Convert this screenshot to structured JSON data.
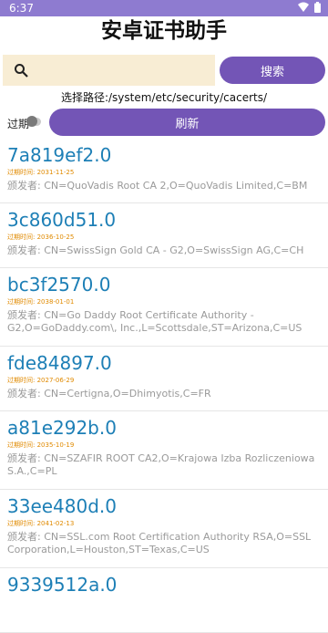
{
  "status": {
    "time": "6:37"
  },
  "app": {
    "title": "安卓证书助手"
  },
  "search": {
    "placeholder": "",
    "value": "",
    "button_label": "搜索"
  },
  "path": {
    "text": "选择路径:/system/etc/security/cacerts/"
  },
  "toggle": {
    "label": "过期",
    "on": false
  },
  "refresh": {
    "label": "刷新"
  },
  "labels": {
    "date_prefix": "过期时间: ",
    "issuer_prefix": "颁发者: "
  },
  "certificates": [
    {
      "name": "7a819ef2.0",
      "expiry": "2031-11-25",
      "issuer": "CN=QuoVadis Root CA 2,O=QuoVadis Limited,C=BM"
    },
    {
      "name": "3c860d51.0",
      "expiry": "2036-10-25",
      "issuer": "CN=SwissSign Gold CA - G2,O=SwissSign AG,C=CH"
    },
    {
      "name": "bc3f2570.0",
      "expiry": "2038-01-01",
      "issuer": "CN=Go Daddy Root Certificate Authority - G2,O=GoDaddy.com\\, Inc.,L=Scottsdale,ST=Arizona,C=US"
    },
    {
      "name": "fde84897.0",
      "expiry": "2027-06-29",
      "issuer": "CN=Certigna,O=Dhimyotis,C=FR"
    },
    {
      "name": "a81e292b.0",
      "expiry": "2035-10-19",
      "issuer": "CN=SZAFIR ROOT CA2,O=Krajowa Izba Rozliczeniowa S.A.,C=PL"
    },
    {
      "name": "33ee480d.0",
      "expiry": "2041-02-13",
      "issuer": "CN=SSL.com Root Certification Authority RSA,O=SSL Corporation,L=Houston,ST=Texas,C=US"
    },
    {
      "name": "9339512a.0",
      "expiry": "",
      "issuer": ""
    }
  ],
  "colors": {
    "accent": "#7355b6",
    "status_bar": "#8e7bd0",
    "cert_name": "#1d7fb6",
    "expiry": "#e08a00",
    "search_bg": "#f8edd4"
  }
}
